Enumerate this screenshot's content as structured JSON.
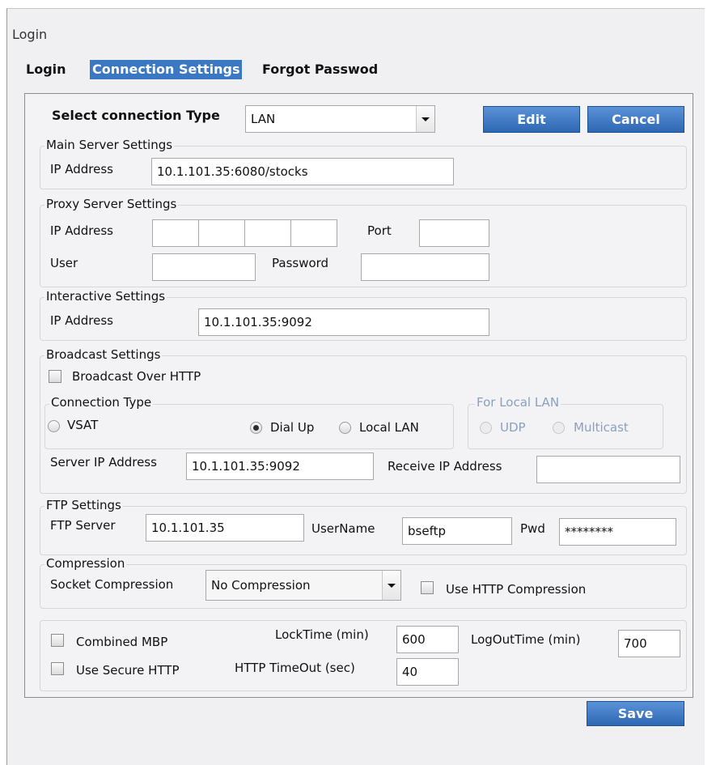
{
  "window": {
    "title": "Login"
  },
  "tabs": [
    {
      "label": "Login"
    },
    {
      "label": "Connection Settings"
    },
    {
      "label": "Forgot Passwod"
    }
  ],
  "connection": {
    "label": "Select connection Type",
    "value": "LAN"
  },
  "buttons": {
    "edit": "Edit",
    "cancel": "Cancel",
    "save": "Save"
  },
  "main_server": {
    "legend": "Main Server Settings",
    "ip_label": "IP Address",
    "ip_value": "10.1.101.35:6080/stocks"
  },
  "proxy": {
    "legend": "Proxy Server Settings",
    "ip_label": "IP Address",
    "ip_parts": [
      "",
      "",
      "",
      ""
    ],
    "port_label": "Port",
    "port_value": "",
    "user_label": "User",
    "user_value": "",
    "password_label": "Password",
    "password_value": ""
  },
  "interactive": {
    "legend": "Interactive Settings",
    "ip_label": "IP Address",
    "ip_value": "10.1.101.35:9092"
  },
  "broadcast": {
    "legend": "Broadcast Settings",
    "over_http_label": "Broadcast Over HTTP",
    "over_http_checked": false,
    "connection_type": {
      "legend": "Connection Type",
      "options": [
        "VSAT",
        "Dial Up",
        "Local LAN"
      ],
      "selected": "Dial Up"
    },
    "local_lan": {
      "legend": "For Local LAN",
      "options": [
        "UDP",
        "Multicast"
      ]
    },
    "server_ip_label": "Server IP Address",
    "server_ip_value": "10.1.101.35:9092",
    "receive_ip_label": "Receive IP Address",
    "receive_ip_value": ""
  },
  "ftp": {
    "legend": "FTP Settings",
    "server_label": "FTP Server",
    "server_value": "10.1.101.35",
    "username_label": "UserName",
    "username_value": "bseftp",
    "pwd_label": "Pwd",
    "pwd_value": "********"
  },
  "compression": {
    "legend": "Compression",
    "socket_label": "Socket Compression",
    "socket_value": "No Compression",
    "use_http_label": "Use HTTP Compression",
    "use_http_checked": false
  },
  "misc": {
    "combined_mbp_label": "Combined MBP",
    "secure_http_label": "Use Secure HTTP",
    "locktime_label": "LockTime (min)",
    "locktime_value": "600",
    "logout_label": "LogOutTime (min)",
    "logout_value": "700",
    "timeout_label": "HTTP TimeOut (sec)",
    "timeout_value": "40"
  },
  "colors": {
    "accent": "#3b78c2",
    "button": "#2e67b3"
  }
}
